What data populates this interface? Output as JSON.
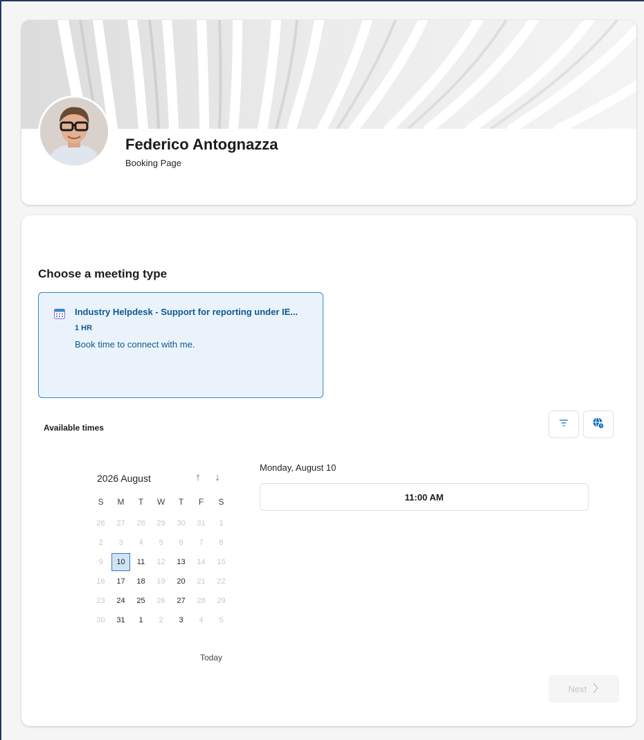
{
  "host": {
    "name": "Federico Antognazza",
    "subtitle": "Booking Page"
  },
  "meeting_section": {
    "title": "Choose a meeting type",
    "meeting": {
      "icon": "calendar-icon",
      "title": "Industry Helpdesk - Support for reporting under IE...",
      "duration": "1 HR",
      "description": "Book time to connect with me."
    }
  },
  "availability": {
    "label": "Available times",
    "filter_icon": "filter-icon",
    "timezone_icon": "globe-clock-icon"
  },
  "calendar": {
    "month_label": "2026 August",
    "nav_up": "↑",
    "nav_down": "↓",
    "weekdays": [
      "S",
      "M",
      "T",
      "W",
      "T",
      "F",
      "S"
    ],
    "weeks": [
      [
        {
          "d": "26",
          "s": "dim"
        },
        {
          "d": "27",
          "s": "dim"
        },
        {
          "d": "28",
          "s": "dim"
        },
        {
          "d": "29",
          "s": "dim"
        },
        {
          "d": "30",
          "s": "dim"
        },
        {
          "d": "31",
          "s": "dim"
        },
        {
          "d": "1",
          "s": "dim"
        }
      ],
      [
        {
          "d": "2",
          "s": "dim"
        },
        {
          "d": "3",
          "s": "dim"
        },
        {
          "d": "4",
          "s": "dim"
        },
        {
          "d": "5",
          "s": "dim"
        },
        {
          "d": "6",
          "s": "dim"
        },
        {
          "d": "7",
          "s": "dim"
        },
        {
          "d": "8",
          "s": "dim"
        }
      ],
      [
        {
          "d": "9",
          "s": "dim"
        },
        {
          "d": "10",
          "s": "sel"
        },
        {
          "d": "11",
          "s": "avail"
        },
        {
          "d": "12",
          "s": "dim"
        },
        {
          "d": "13",
          "s": "avail"
        },
        {
          "d": "14",
          "s": "dim"
        },
        {
          "d": "15",
          "s": "dim"
        }
      ],
      [
        {
          "d": "16",
          "s": "dim"
        },
        {
          "d": "17",
          "s": "avail"
        },
        {
          "d": "18",
          "s": "avail"
        },
        {
          "d": "19",
          "s": "dim"
        },
        {
          "d": "20",
          "s": "avail"
        },
        {
          "d": "21",
          "s": "dim"
        },
        {
          "d": "22",
          "s": "dim"
        }
      ],
      [
        {
          "d": "23",
          "s": "dim"
        },
        {
          "d": "24",
          "s": "avail"
        },
        {
          "d": "25",
          "s": "avail"
        },
        {
          "d": "26",
          "s": "dim"
        },
        {
          "d": "27",
          "s": "avail"
        },
        {
          "d": "28",
          "s": "dim"
        },
        {
          "d": "29",
          "s": "dim"
        }
      ],
      [
        {
          "d": "30",
          "s": "dim"
        },
        {
          "d": "31",
          "s": "avail"
        },
        {
          "d": "1",
          "s": "avail"
        },
        {
          "d": "2",
          "s": "dim"
        },
        {
          "d": "3",
          "s": "avail"
        },
        {
          "d": "4",
          "s": "dim"
        },
        {
          "d": "5",
          "s": "dim"
        }
      ]
    ],
    "today_label": "Today"
  },
  "times": {
    "date_heading": "Monday, August 10",
    "slots": [
      "11:00 AM"
    ]
  },
  "actions": {
    "next_label": "Next",
    "next_icon": "chevron-right-icon"
  },
  "colors": {
    "accent": "#0f5a8f",
    "selected_card_bg": "#eaf3fc",
    "selected_card_border": "#2b88d8",
    "selected_day_bg": "#cfe3f5"
  }
}
